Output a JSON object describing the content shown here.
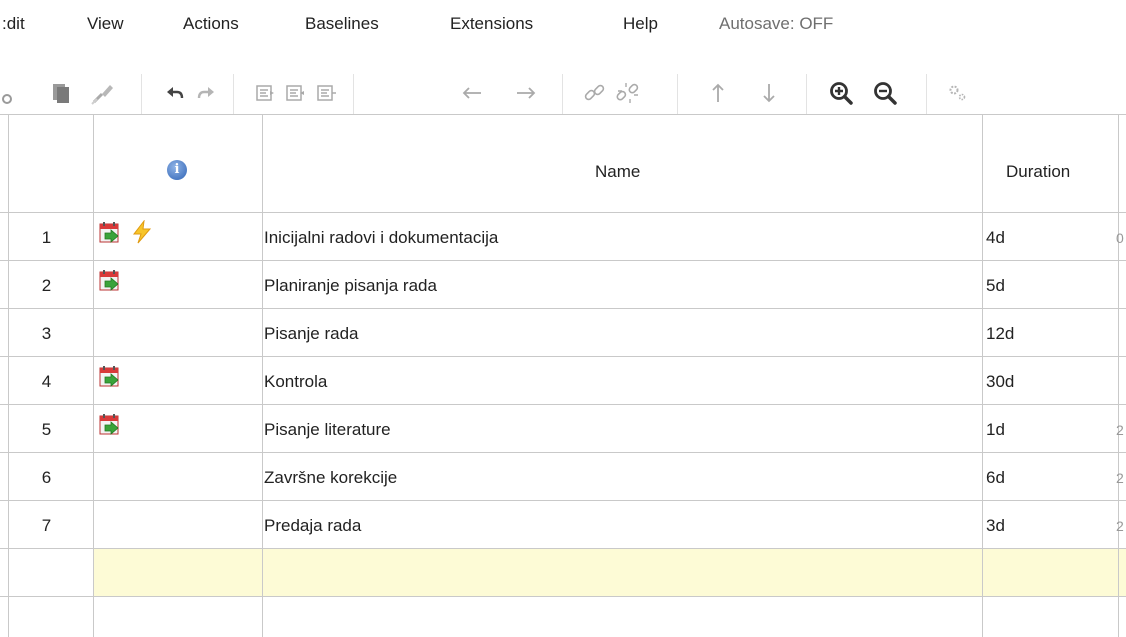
{
  "menu": {
    "items": [
      "Edit",
      "View",
      "Actions",
      "Baselines",
      "Extensions",
      "Help"
    ],
    "edit_visible_text": ":dit",
    "autosave": "Autosave: OFF"
  },
  "toolbar": {
    "icons": [
      "cut-icon",
      "copy-icon",
      "paste-format-icon",
      "undo-icon",
      "redo-icon",
      "indent-icon",
      "outdent-icon",
      "move-icon",
      "arrow-left-icon",
      "arrow-right-icon",
      "link-icon",
      "unlink-icon",
      "arrow-up-icon",
      "arrow-down-icon",
      "zoom-in-icon",
      "zoom-out-icon",
      "settings-icon"
    ]
  },
  "grid": {
    "columns": {
      "info": "i",
      "name": "Name",
      "duration": "Duration"
    },
    "rows": [
      {
        "num": "1",
        "name": "Inicijalni radovi i dokumentacija",
        "duration": "4d",
        "edge": "0",
        "icons": [
          "task-icon",
          "bolt-icon"
        ]
      },
      {
        "num": "2",
        "name": "Planiranje pisanja rada",
        "duration": "5d",
        "edge": "",
        "icons": [
          "task-icon"
        ]
      },
      {
        "num": "3",
        "name": "Pisanje rada",
        "duration": "12d",
        "edge": "",
        "icons": []
      },
      {
        "num": "4",
        "name": "Kontrola",
        "duration": "30d",
        "edge": "",
        "icons": [
          "task-icon"
        ]
      },
      {
        "num": "5",
        "name": "Pisanje literature",
        "duration": "1d",
        "edge": "2",
        "icons": [
          "task-icon"
        ]
      },
      {
        "num": "6",
        "name": "Završne korekcije",
        "duration": "6d",
        "edge": "2",
        "icons": []
      },
      {
        "num": "7",
        "name": "Predaja rada",
        "duration": "3d",
        "edge": "2",
        "icons": []
      }
    ]
  },
  "colors": {
    "selected_row": "#fdfbd6",
    "grid_line": "#c9c9c9",
    "info_icon": "#2f63b5"
  }
}
